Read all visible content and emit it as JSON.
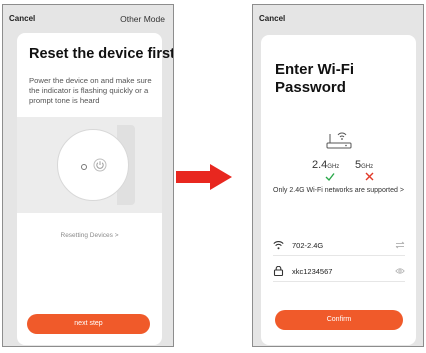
{
  "left_screen": {
    "cancel_label": "Cancel",
    "other_mode_label": "Other Mode",
    "title": "Reset the device first.",
    "description": "Power the device on and make sure the indicator is flashing quickly or a prompt tone is heard",
    "resetting_link": "Resetting Devices >",
    "next_button": "next step"
  },
  "arrow": {
    "color": "#e8271f"
  },
  "right_screen": {
    "cancel_label": "Cancel",
    "title": "Enter Wi-Fi Password",
    "band_24": "2.4",
    "band_24_unit": "GHz",
    "band_5": "5",
    "band_5_unit": "GHz",
    "support_note": "Only 2.4G Wi-Fi networks are supported >",
    "ssid_value": "702-2.4G",
    "password_value": "xkc1234567",
    "confirm_button": "Confirm"
  },
  "colors": {
    "accent": "#f05a2a",
    "check": "#2aa84a",
    "cross": "#e23b2a",
    "frame_bg": "#e5e5e5"
  },
  "icons": {
    "router": "wifi-router-icon",
    "check": "check-icon",
    "cross": "cross-icon",
    "wifi": "wifi-icon",
    "lock": "lock-icon",
    "switch": "switch-network-icon",
    "eye": "eye-icon",
    "power": "power-icon"
  }
}
